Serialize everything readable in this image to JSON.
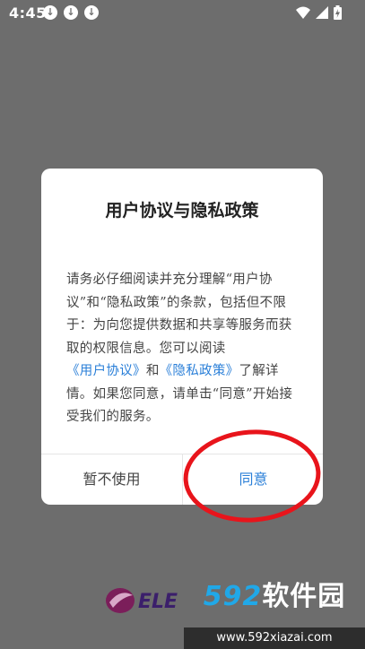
{
  "status_bar": {
    "time": "4:45",
    "notification_icons": [
      "download-icon",
      "download-icon",
      "download-icon"
    ],
    "right_icons": [
      "wifi-icon",
      "signal-icon",
      "battery-charging-icon"
    ]
  },
  "dialog": {
    "title": "用户协议与隐私政策",
    "body_part1": "请务必仔细阅读并充分理解“用户协议”和“隐私政策”的条款，包括但不限于：为向您提供数据和共享等服务而获取的权限信息。您可以阅读",
    "link_user_agreement": "《用户协议》",
    "body_and": "和",
    "link_privacy_policy": "《隐私政策》",
    "body_part2": "了解详情。如果您同意，请单击“同意”开始接受我们的服务。",
    "cancel_label": "暂不使用",
    "agree_label": "同意"
  },
  "splash": {
    "logo_text": "ELE"
  },
  "watermark": {
    "brand_number": "592",
    "brand_text": "软件园",
    "url": "www.592xiazai.com"
  },
  "colors": {
    "overlay": "#6d6d6d",
    "link": "#2a7fd8",
    "annotation_circle": "#e8141b",
    "watermark_blue": "#20a8e8"
  }
}
